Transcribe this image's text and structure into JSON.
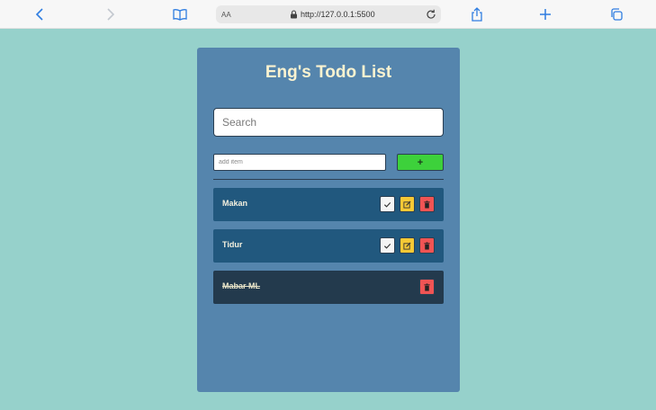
{
  "browser": {
    "url": "http://127.0.0.1:5500",
    "text_size_label": "AA"
  },
  "app": {
    "title": "Eng's Todo List",
    "search_placeholder": "Search",
    "add_placeholder": "add item",
    "add_button_label": "+"
  },
  "todos": [
    {
      "label": "Makan",
      "done": false
    },
    {
      "label": "Tidur",
      "done": false
    },
    {
      "label": "Mabar ML",
      "done": true
    }
  ],
  "colors": {
    "background": "#96d1cb",
    "card": "#5585ad",
    "item": "#21587e",
    "item_done": "#233a4d",
    "add_button": "#3dd13b",
    "edit_button": "#f6c935",
    "delete_button": "#f05454",
    "title": "#fbf3d0"
  }
}
